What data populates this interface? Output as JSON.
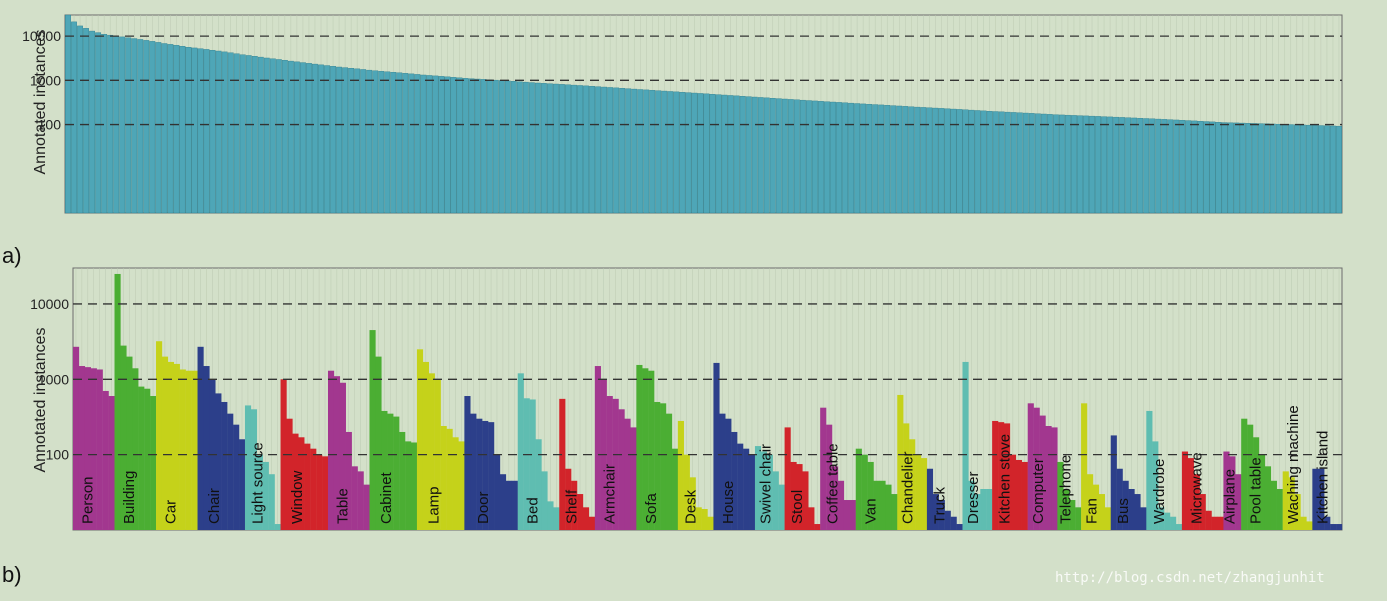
{
  "chart_data": [
    {
      "type": "bar",
      "panel_label": "a)",
      "ylabel": "Annotated instances",
      "yscale": "log",
      "ylim": [
        1,
        30000
      ],
      "yticks": [
        "100",
        "1000",
        "10000"
      ],
      "reference_lines": [
        100,
        1000,
        10000
      ],
      "categories": [],
      "values": [
        30000,
        21000,
        17000,
        15000,
        13000,
        12000,
        11000,
        10500,
        10000,
        9600,
        9200,
        8800,
        8400,
        8000,
        7600,
        7200,
        6800,
        6500,
        6200,
        5900,
        5600,
        5400,
        5200,
        5000,
        4800,
        4600,
        4400,
        4200,
        4000,
        3800,
        3650,
        3500,
        3350,
        3200,
        3080,
        2960,
        2840,
        2720,
        2620,
        2520,
        2420,
        2330,
        2240,
        2160,
        2080,
        2000,
        1940,
        1880,
        1820,
        1760,
        1700,
        1650,
        1600,
        1560,
        1520,
        1480,
        1440,
        1400,
        1360,
        1320,
        1290,
        1260,
        1230,
        1200,
        1170,
        1140,
        1110,
        1090,
        1070,
        1050,
        1030,
        1010,
        990,
        970,
        950,
        930,
        910,
        890,
        870,
        855,
        840,
        825,
        810,
        795,
        780,
        765,
        750,
        735,
        720,
        705,
        690,
        676,
        662,
        648,
        634,
        620,
        608,
        596,
        584,
        572,
        560,
        549,
        538,
        527,
        516,
        505,
        495,
        485,
        475,
        465,
        455,
        446,
        437,
        428,
        419,
        410,
        402,
        394,
        386,
        378,
        370,
        363,
        356,
        349,
        342,
        335,
        329,
        323,
        317,
        311,
        305,
        299,
        293,
        288,
        283,
        278,
        273,
        268,
        263,
        258,
        253,
        248,
        244,
        240,
        236,
        232,
        228,
        224,
        220,
        216,
        212,
        208,
        204,
        200,
        197,
        194,
        191,
        188,
        185,
        182,
        179,
        176,
        173,
        170,
        167,
        165,
        163,
        161,
        159,
        157,
        155,
        153,
        151,
        149,
        147,
        145,
        143,
        141,
        139,
        137,
        135,
        133,
        131,
        129,
        127,
        125,
        123,
        121,
        119,
        117,
        115,
        113,
        111,
        110,
        109,
        108,
        107,
        106,
        105,
        104,
        103,
        102,
        101,
        100,
        99,
        98,
        97,
        96,
        95,
        94,
        93,
        92
      ]
    },
    {
      "type": "bar",
      "panel_label": "b)",
      "ylabel": "Annotated instances",
      "yscale": "log",
      "ylim": [
        10,
        30000
      ],
      "yticks": [
        "100",
        "1000",
        "10000"
      ],
      "reference_lines": [
        100,
        1000,
        10000
      ],
      "groups": [
        {
          "name": "Person",
          "color": "#a2378f",
          "values": [
            2700,
            1500,
            1450,
            1400,
            1350,
            700,
            600
          ]
        },
        {
          "name": "Building",
          "color": "#4bae33",
          "values": [
            25000,
            2800,
            2000,
            1400,
            800,
            750,
            600
          ]
        },
        {
          "name": "Car",
          "color": "#c5d21a",
          "values": [
            3200,
            2000,
            1700,
            1600,
            1350,
            1300,
            1300
          ]
        },
        {
          "name": "Chair",
          "color": "#2c3f8a",
          "values": [
            2700,
            1500,
            1000,
            650,
            500,
            350,
            250,
            160
          ]
        },
        {
          "name": "Light source",
          "color": "#5fbdb1",
          "values": [
            450,
            400,
            100,
            80,
            55,
            12
          ]
        },
        {
          "name": "Window",
          "color": "#d2242a",
          "values": [
            1000,
            300,
            190,
            170,
            140,
            120,
            100,
            95
          ]
        },
        {
          "name": "Table",
          "color": "#a2378f",
          "values": [
            1300,
            1100,
            900,
            200,
            70,
            60,
            40
          ]
        },
        {
          "name": "Cabinet",
          "color": "#4bae33",
          "values": [
            4500,
            2000,
            380,
            350,
            320,
            200,
            150,
            145
          ]
        },
        {
          "name": "Lamp",
          "color": "#c5d21a",
          "values": [
            2500,
            1700,
            1200,
            1000,
            240,
            220,
            170,
            150
          ]
        },
        {
          "name": "Door",
          "color": "#2c3f8a",
          "values": [
            600,
            350,
            300,
            280,
            270,
            100,
            55,
            45,
            45
          ]
        },
        {
          "name": "Bed",
          "color": "#5fbdb1",
          "values": [
            1200,
            560,
            540,
            160,
            60,
            24,
            20
          ]
        },
        {
          "name": "Shelf",
          "color": "#d2242a",
          "values": [
            550,
            65,
            45,
            30,
            20,
            15
          ]
        },
        {
          "name": "Armchair",
          "color": "#a2378f",
          "values": [
            1500,
            1000,
            600,
            550,
            400,
            300,
            230
          ]
        },
        {
          "name": "Sofa",
          "color": "#4bae33",
          "values": [
            1550,
            1400,
            1300,
            500,
            480,
            350,
            120
          ]
        },
        {
          "name": "Desk",
          "color": "#c5d21a",
          "values": [
            280,
            100,
            50,
            20,
            19,
            15
          ]
        },
        {
          "name": "House",
          "color": "#2c3f8a",
          "values": [
            1650,
            350,
            300,
            200,
            140,
            120,
            100
          ]
        },
        {
          "name": "Swivel chair",
          "color": "#5fbdb1",
          "values": [
            130,
            110,
            100,
            60,
            40
          ]
        },
        {
          "name": "Stool",
          "color": "#d2242a",
          "values": [
            230,
            80,
            75,
            60,
            20,
            12
          ]
        },
        {
          "name": "Coffee table",
          "color": "#a2378f",
          "values": [
            420,
            250,
            70,
            45,
            25,
            25
          ]
        },
        {
          "name": "Van",
          "color": "#4bae33",
          "values": [
            120,
            100,
            80,
            45,
            45,
            40,
            30
          ]
        },
        {
          "name": "Chandelier",
          "color": "#c5d21a",
          "values": [
            620,
            260,
            160,
            100,
            90
          ]
        },
        {
          "name": "Truck",
          "color": "#2c3f8a",
          "values": [
            65,
            30,
            25,
            18,
            15,
            12
          ]
        },
        {
          "name": "Dresser",
          "color": "#5fbdb1",
          "values": [
            1700,
            45,
            30,
            35,
            35
          ]
        },
        {
          "name": "Kitchen stove",
          "color": "#d2242a",
          "values": [
            280,
            270,
            260,
            100,
            85,
            80
          ]
        },
        {
          "name": "Computer",
          "color": "#a2378f",
          "values": [
            480,
            420,
            330,
            240,
            230
          ]
        },
        {
          "name": "Telephone",
          "color": "#4bae33",
          "values": [
            80,
            35,
            25,
            20
          ]
        },
        {
          "name": "Fan",
          "color": "#c5d21a",
          "values": [
            480,
            55,
            40,
            30,
            20
          ]
        },
        {
          "name": "Bus",
          "color": "#2c3f8a",
          "values": [
            180,
            65,
            45,
            35,
            30,
            20
          ]
        },
        {
          "name": "Wardrobe",
          "color": "#5fbdb1",
          "values": [
            380,
            150,
            20,
            17,
            15,
            12
          ]
        },
        {
          "name": "Microwave",
          "color": "#d2242a",
          "values": [
            110,
            90,
            55,
            30,
            18,
            15,
            15
          ]
        },
        {
          "name": "Airplane",
          "color": "#a2378f",
          "values": [
            110,
            95,
            55
          ]
        },
        {
          "name": "Pool table",
          "color": "#4bae33",
          "values": [
            300,
            250,
            170,
            100,
            70,
            45,
            35
          ]
        },
        {
          "name": "Waching machine",
          "color": "#c5d21a",
          "values": [
            60,
            50,
            30,
            15,
            13
          ]
        },
        {
          "name": "Kitchen island",
          "color": "#2c3f8a",
          "values": [
            65,
            65,
            15,
            12,
            12
          ]
        }
      ]
    }
  ],
  "watermark": "http://blog.csdn.net/zhangjunhit"
}
